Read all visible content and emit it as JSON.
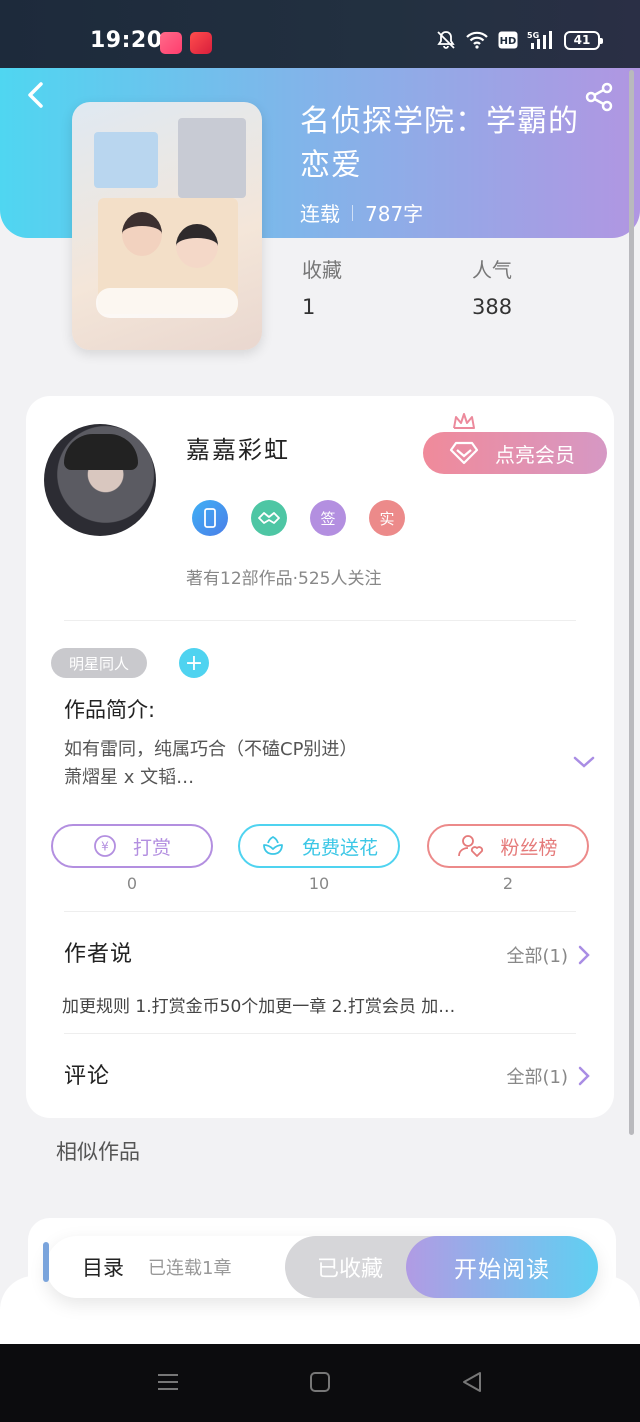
{
  "status_bar": {
    "time": "19:20",
    "battery": "41",
    "network": "5G"
  },
  "book": {
    "title": "名侦探学院：学霸的恋爱",
    "status": "连载",
    "word_count": "787字",
    "collect_label": "收藏",
    "collect_value": "1",
    "popularity_label": "人气",
    "popularity_value": "388"
  },
  "author": {
    "name": "嘉嘉彩虹",
    "stats": "著有12部作品·525人关注",
    "vip_button": "点亮会员",
    "badges": [
      "phone-badge",
      "handshake-badge",
      "签",
      "实"
    ]
  },
  "tag": {
    "label": "明星同人",
    "add_label": "+"
  },
  "intro": {
    "label": "作品简介:",
    "line1": "如有雷同，纯属巧合（不磕CP别进）",
    "line2": "萧熠星 x 文韬…"
  },
  "actions": {
    "reward": {
      "label": "打赏",
      "count": "0"
    },
    "flower": {
      "label": "免费送花",
      "count": "10"
    },
    "fans": {
      "label": "粉丝榜",
      "count": "2"
    }
  },
  "author_says": {
    "title": "作者说",
    "more": "全部(1)",
    "text": "加更规则 1.打赏金币50个加更一章 2.打赏会员 加…"
  },
  "comments": {
    "title": "评论",
    "more": "全部(1)"
  },
  "similar": {
    "title": "相似作品"
  },
  "bottom_bar": {
    "toc_label": "目录",
    "toc_sub": "已连载1章",
    "fav_label": "已收藏",
    "read_label": "开始阅读"
  },
  "colors": {
    "hero_start": "#4fd6f1",
    "hero_end": "#b196e2",
    "reward": "#b38fe0",
    "flower": "#4fd3f0",
    "fans": "#ec8a8a",
    "accent_purple": "#a98de4"
  }
}
